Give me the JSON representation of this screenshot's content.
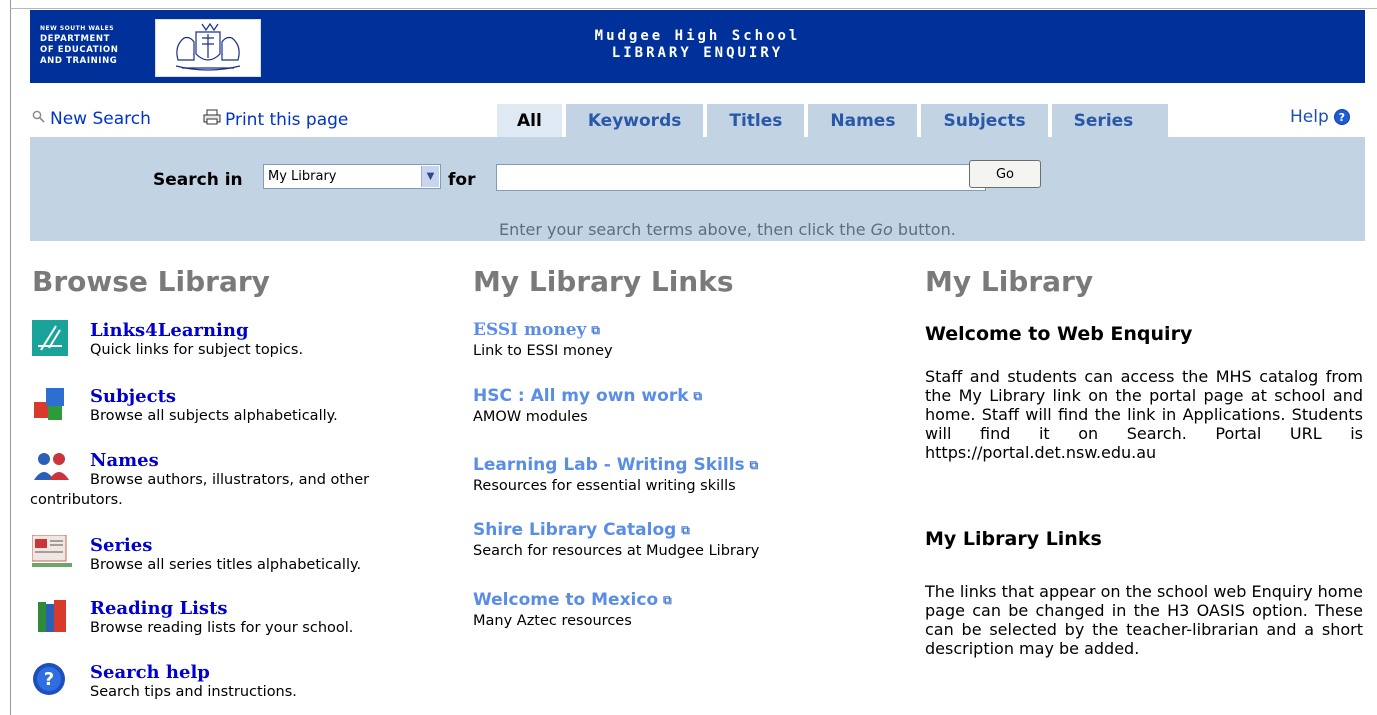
{
  "header": {
    "dept_line1": "NEW SOUTH WALES",
    "dept_line2": "DEPARTMENT",
    "dept_line3": "OF EDUCATION",
    "dept_line4": "AND TRAINING",
    "school": "Mudgee High School",
    "subtitle": "LIBRARY ENQUIRY"
  },
  "toolbar": {
    "new_search": "New Search",
    "print": "Print this page",
    "help": "Help"
  },
  "tabs": [
    {
      "label": "All",
      "active": true
    },
    {
      "label": "Keywords"
    },
    {
      "label": "Titles"
    },
    {
      "label": "Names"
    },
    {
      "label": "Subjects"
    },
    {
      "label": "Series"
    }
  ],
  "search": {
    "search_in_label": "Search in",
    "scope_value": "My Library",
    "for_label": "for",
    "query_value": "",
    "go_label": "Go",
    "hint_before": "Enter your search terms above, then click the ",
    "hint_italic": "Go",
    "hint_after": " button."
  },
  "browse": {
    "title": "Browse Library",
    "items": [
      {
        "title": "Links4Learning",
        "desc": "Quick links for subject topics.",
        "icon": "links4learning-icon"
      },
      {
        "title": "Subjects",
        "desc": "Browse all subjects alphabetically.",
        "icon": "subjects-icon"
      },
      {
        "title": "Names",
        "desc": "Browse authors, illustrators, and other",
        "desc2": "contributors.",
        "icon": "names-icon"
      },
      {
        "title": "Series",
        "desc": "Browse all series titles alphabetically.",
        "icon": "series-icon"
      },
      {
        "title": "Reading Lists",
        "desc": "Browse reading lists for your school.",
        "icon": "books-icon"
      },
      {
        "title": "Search help",
        "desc": "Search tips and instructions.",
        "icon": "help-question-icon"
      }
    ]
  },
  "links": {
    "title": "My Library Links",
    "items": [
      {
        "title": "ESSI money",
        "desc": "Link to ESSI money"
      },
      {
        "title": "HSC : All my own work",
        "desc": "AMOW modules"
      },
      {
        "title": "Learning Lab - Writing Skills",
        "desc": "Resources for essential writing skills"
      },
      {
        "title": "Shire Library Catalog",
        "desc": "Search for resources at Mudgee Library"
      },
      {
        "title": "Welcome to Mexico",
        "desc": "Many Aztec resources"
      }
    ]
  },
  "mylibrary": {
    "title": "My Library",
    "welcome_heading": "Welcome to Web Enquiry",
    "welcome_text": "Staff and students can access the MHS catalog from the My Library link on the portal page at school and home. Staff will find the link in Applications. Students will find it on Search. Portal URL is https://portal.det.nsw.edu.au",
    "links_heading": "My Library Links",
    "links_text": "The links that appear on the school web Enquiry home page can be changed in the H3 OASIS option. These can be selected by the teacher-librarian and a short description may be added."
  }
}
